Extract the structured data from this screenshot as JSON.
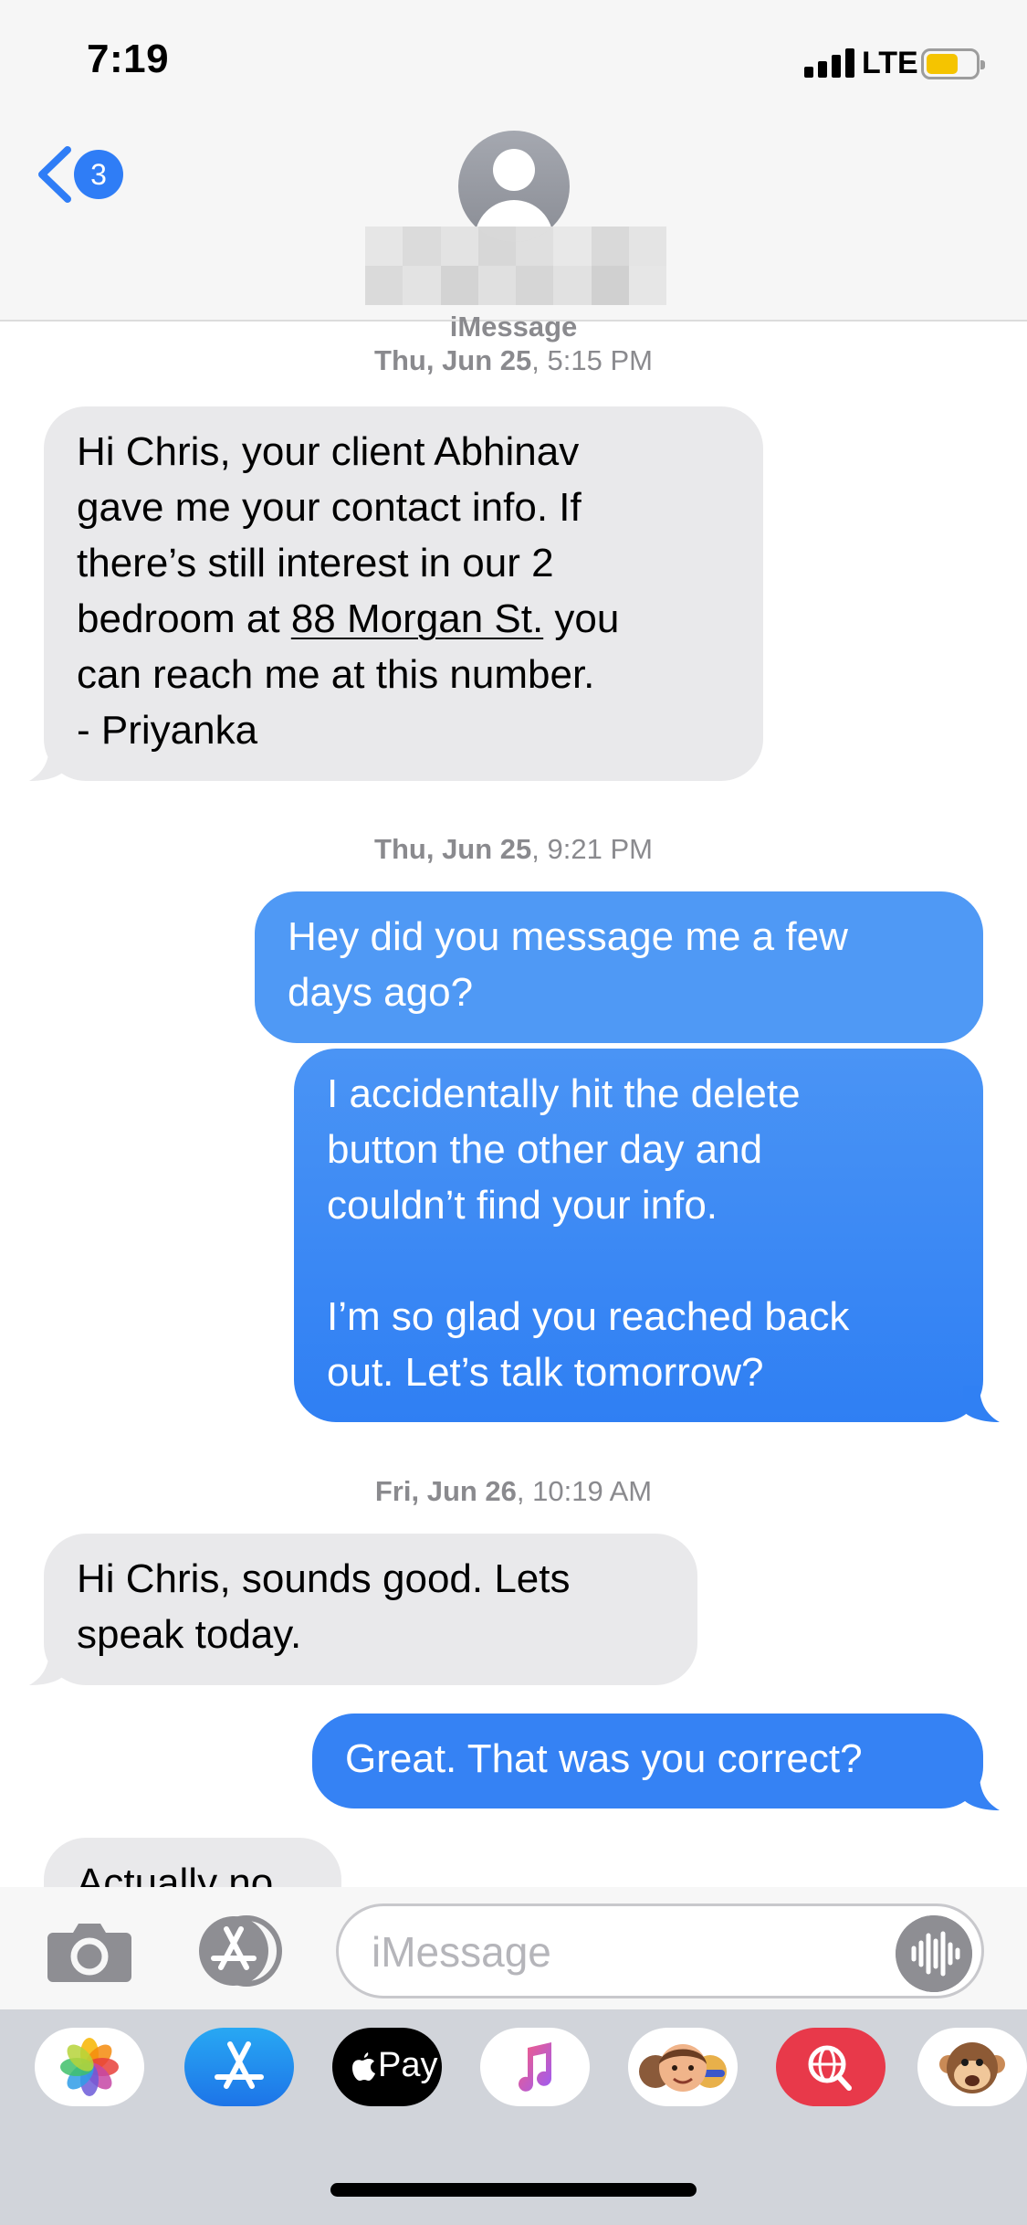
{
  "status_bar": {
    "time": "7:19",
    "network": "LTE"
  },
  "header": {
    "back_count": "3"
  },
  "thread": {
    "service_label": "iMessage",
    "timestamps": [
      {
        "day": "Thu, Jun 25",
        "time": ", 5:15 PM"
      },
      {
        "day": "Thu, Jun 25",
        "time": ", 9:21 PM"
      },
      {
        "day": "Fri, Jun 26",
        "time": ", 10:19 AM"
      }
    ],
    "messages": [
      {
        "direction": "received",
        "text_before_link": "Hi Chris, your client Abhinav\ngave me your contact info. If\nthere’s still interest in our 2\nbedroom at ",
        "link": "88 Morgan St.",
        "text_after_link": " you\ncan reach me at this number.\n- Priyanka"
      },
      {
        "direction": "sent",
        "text": "Hey did you message me a few\ndays ago?"
      },
      {
        "direction": "sent",
        "text": "I accidentally hit the delete\nbutton the other day and\ncouldn’t find your info.\n\nI’m so glad you reached back\nout. Let’s talk tomorrow?"
      },
      {
        "direction": "received",
        "text": "Hi Chris, sounds good. Lets\nspeak today."
      },
      {
        "direction": "sent",
        "text": "Great. That was you correct?"
      },
      {
        "direction": "received",
        "text": "Actually no"
      }
    ]
  },
  "compose": {
    "placeholder": "iMessage"
  },
  "app_drawer": {
    "apps": [
      {
        "icon": "photos-icon"
      },
      {
        "icon": "app-store-icon"
      },
      {
        "icon": "apple-pay-icon",
        "label": "Pay"
      },
      {
        "icon": "music-icon"
      },
      {
        "icon": "memoji-icon"
      },
      {
        "icon": "web-images-search-icon"
      },
      {
        "icon": "animoji-icon"
      }
    ]
  },
  "colors": {
    "sent_bubble": "#3e8df7",
    "received_bubble": "#e9e9eb",
    "badge": "#2f7df6",
    "battery": "#f5c400"
  }
}
